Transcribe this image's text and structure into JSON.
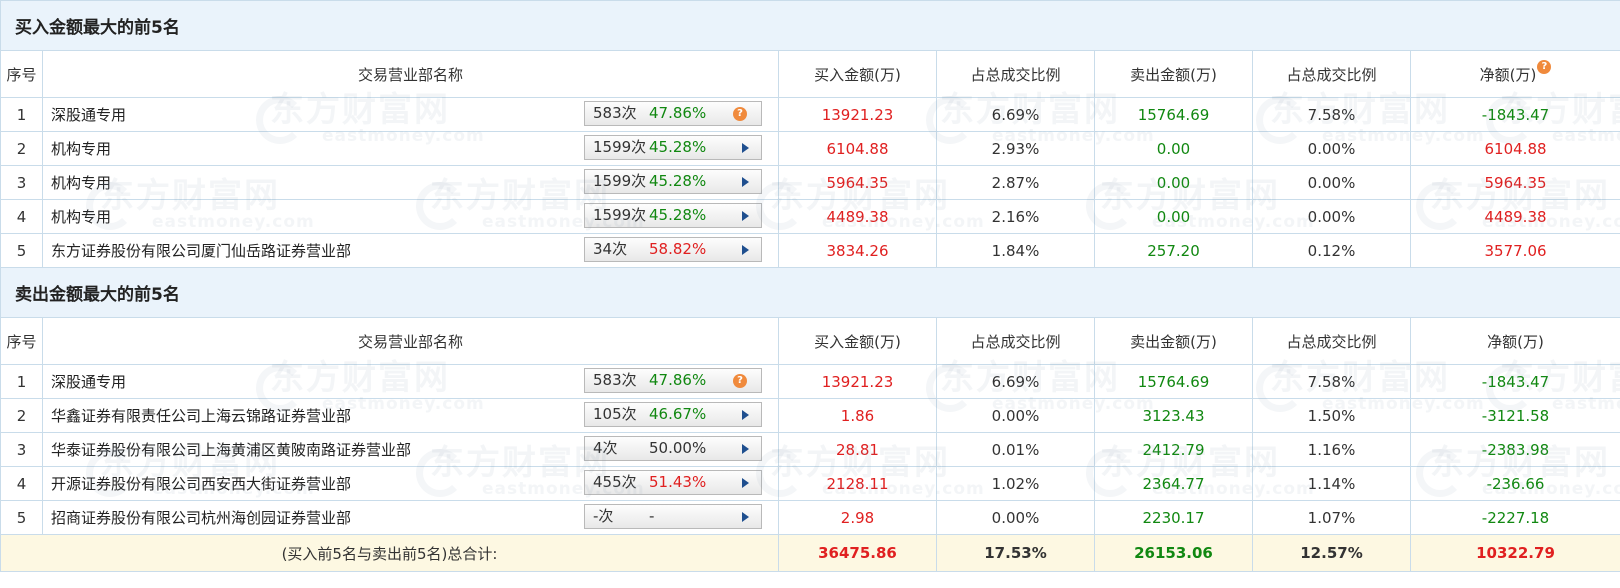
{
  "buy_section": {
    "title": "买入金额最大的前5名",
    "headers": [
      "序号",
      "交易营业部名称",
      "买入金额(万)",
      "占总成交比例",
      "卖出金额(万)",
      "占总成交比例",
      "净额(万)"
    ],
    "rows": [
      {
        "no": "1",
        "name": "深股通专用",
        "count": "583次",
        "pct": "47.86%",
        "pct_color": "green",
        "icon": "help",
        "buy": "13921.23",
        "buy_ratio": "6.69%",
        "sell": "15764.69",
        "sell_ratio": "7.58%",
        "net": "-1843.47",
        "net_color": "green"
      },
      {
        "no": "2",
        "name": "机构专用",
        "count": "1599次",
        "pct": "45.28%",
        "pct_color": "green",
        "icon": "arrow",
        "buy": "6104.88",
        "buy_ratio": "2.93%",
        "sell": "0.00",
        "sell_ratio": "0.00%",
        "net": "6104.88",
        "net_color": "red"
      },
      {
        "no": "3",
        "name": "机构专用",
        "count": "1599次",
        "pct": "45.28%",
        "pct_color": "green",
        "icon": "arrow",
        "buy": "5964.35",
        "buy_ratio": "2.87%",
        "sell": "0.00",
        "sell_ratio": "0.00%",
        "net": "5964.35",
        "net_color": "red"
      },
      {
        "no": "4",
        "name": "机构专用",
        "count": "1599次",
        "pct": "45.28%",
        "pct_color": "green",
        "icon": "arrow",
        "buy": "4489.38",
        "buy_ratio": "2.16%",
        "sell": "0.00",
        "sell_ratio": "0.00%",
        "net": "4489.38",
        "net_color": "red"
      },
      {
        "no": "5",
        "name": "东方证券股份有限公司厦门仙岳路证券营业部",
        "count": "34次",
        "pct": "58.82%",
        "pct_color": "red",
        "icon": "arrow",
        "buy": "3834.26",
        "buy_ratio": "1.84%",
        "sell": "257.20",
        "sell_ratio": "0.12%",
        "net": "3577.06",
        "net_color": "red"
      }
    ]
  },
  "sell_section": {
    "title": "卖出金额最大的前5名",
    "headers": [
      "序号",
      "交易营业部名称",
      "买入金额(万)",
      "占总成交比例",
      "卖出金额(万)",
      "占总成交比例",
      "净额(万)"
    ],
    "rows": [
      {
        "no": "1",
        "name": "深股通专用",
        "count": "583次",
        "pct": "47.86%",
        "pct_color": "green",
        "icon": "help",
        "buy": "13921.23",
        "buy_ratio": "6.69%",
        "sell": "15764.69",
        "sell_ratio": "7.58%",
        "net": "-1843.47",
        "net_color": "green"
      },
      {
        "no": "2",
        "name": "华鑫证券有限责任公司上海云锦路证券营业部",
        "count": "105次",
        "pct": "46.67%",
        "pct_color": "green",
        "icon": "arrow",
        "buy": "1.86",
        "buy_ratio": "0.00%",
        "sell": "3123.43",
        "sell_ratio": "1.50%",
        "net": "-3121.58",
        "net_color": "green"
      },
      {
        "no": "3",
        "name": "华泰证券股份有限公司上海黄浦区黄陂南路证券营业部",
        "count": "4次",
        "pct": "50.00%",
        "pct_color": "normal",
        "icon": "arrow",
        "buy": "28.81",
        "buy_ratio": "0.01%",
        "sell": "2412.79",
        "sell_ratio": "1.16%",
        "net": "-2383.98",
        "net_color": "green"
      },
      {
        "no": "4",
        "name": "开源证券股份有限公司西安西大街证券营业部",
        "count": "455次",
        "pct": "51.43%",
        "pct_color": "red",
        "icon": "arrow",
        "buy": "2128.11",
        "buy_ratio": "1.02%",
        "sell": "2364.77",
        "sell_ratio": "1.14%",
        "net": "-236.66",
        "net_color": "green"
      },
      {
        "no": "5",
        "name": "招商证券股份有限公司杭州海创园证券营业部",
        "count": "-次",
        "pct": "-",
        "pct_color": "normal",
        "icon": "arrow",
        "buy": "2.98",
        "buy_ratio": "0.00%",
        "sell": "2230.17",
        "sell_ratio": "1.07%",
        "net": "-2227.18",
        "net_color": "green"
      }
    ]
  },
  "total": {
    "label": "(买入前5名与卖出前5名)总合计:",
    "buy": "36475.86",
    "buy_ratio": "17.53%",
    "sell": "26153.06",
    "sell_ratio": "12.57%",
    "net": "10322.79"
  },
  "help_icon_glyph": "?",
  "watermark": {
    "cn": "东方财富网",
    "en": "eastmoney.com"
  },
  "colors": {
    "red": "#e02020",
    "green": "#118811",
    "section_bg": "#eaf3fb",
    "total_bg": "#fdf8e2",
    "border": "#c9dcea"
  }
}
